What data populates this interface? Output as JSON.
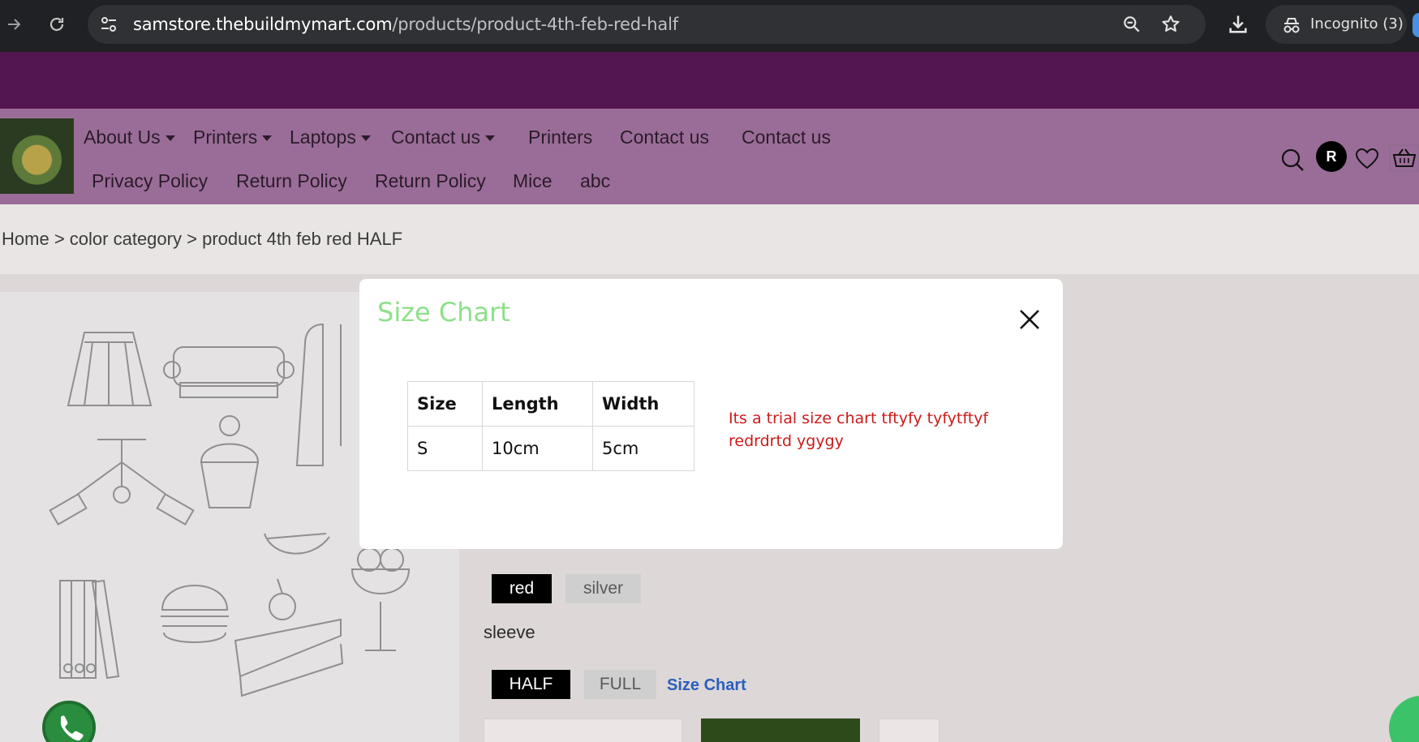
{
  "browser": {
    "url_host": "samstore.thebuildmymart.com",
    "url_path": "/products/product-4th-feb-red-half",
    "incognito_label": "Incognito (3)",
    "icons": [
      "forward-icon",
      "reload-icon",
      "site-settings-icon",
      "zoom-icon",
      "bookmark-star-icon",
      "download-icon",
      "incognito-icon"
    ]
  },
  "nav": {
    "row1": [
      {
        "label": "About Us",
        "dropdown": true
      },
      {
        "label": "Printers",
        "dropdown": true
      },
      {
        "label": "Laptops",
        "dropdown": true
      },
      {
        "label": "Contact us",
        "dropdown": true
      },
      {
        "label": "Printers",
        "dropdown": false
      },
      {
        "label": "Contact us",
        "dropdown": false
      },
      {
        "label": "Contact us",
        "dropdown": false
      }
    ],
    "row2": [
      {
        "label": "Privacy Policy"
      },
      {
        "label": "Return Policy"
      },
      {
        "label": "Return Policy"
      },
      {
        "label": "Mice"
      },
      {
        "label": "abc"
      }
    ],
    "avatar_initial": "R"
  },
  "breadcrumb": {
    "home": "Home",
    "category": "color category",
    "current": "product 4th feb red HALF",
    "separator": ">"
  },
  "product": {
    "colors": [
      {
        "label": "red",
        "selected": true
      },
      {
        "label": "silver",
        "selected": false
      }
    ],
    "sleeve_label": "sleeve",
    "sleeves": [
      {
        "label": "HALF",
        "selected": true
      },
      {
        "label": "FULL",
        "selected": false
      }
    ],
    "size_chart_link": "Size Chart"
  },
  "modal": {
    "title": "Size Chart",
    "table": {
      "headers": [
        "Size",
        "Length",
        "Width"
      ],
      "rows": [
        [
          "S",
          "10cm",
          "5cm"
        ]
      ]
    },
    "note": "Its a trial size chart tftyfy tyfytftyf redrdrtd ygygy"
  },
  "colors": {
    "promo_bar": "#531650",
    "navbar": "#9a6d98",
    "modal_title": "#8ee08a",
    "note_text": "#cc1a1a",
    "link": "#2a5fbd"
  }
}
